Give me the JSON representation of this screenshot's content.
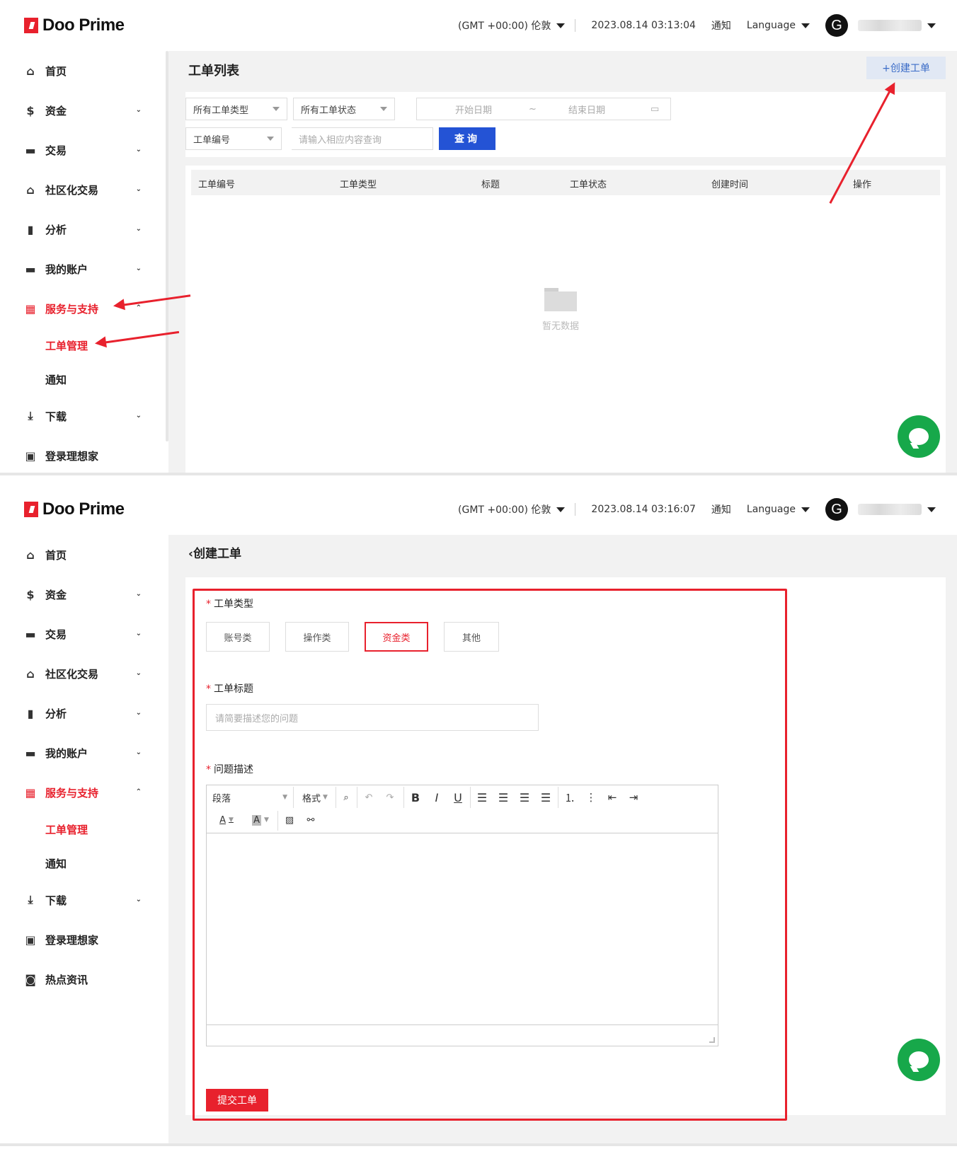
{
  "brand": {
    "name": "Doo Prime",
    "accent": "#e8212d"
  },
  "topbar_1": {
    "timezone": "(GMT +00:00) 伦敦",
    "datetime": "2023.08.14 03:13:04",
    "notify": "通知",
    "language": "Language",
    "avatar_letter": "G"
  },
  "topbar_2": {
    "timezone": "(GMT +00:00) 伦敦",
    "datetime": "2023.08.14 03:16:07",
    "notify": "通知",
    "language": "Language",
    "avatar_letter": "G"
  },
  "menu": {
    "home": "首页",
    "funds": "资金",
    "trade": "交易",
    "social": "社区化交易",
    "analysis": "分析",
    "account": "我的账户",
    "service": "服务与支持",
    "ticket": "工单管理",
    "notice": "通知",
    "download": "下载",
    "wealth": "登录理想家",
    "news": "热点资讯"
  },
  "list": {
    "title": "工单列表",
    "create_button": "+创建工单",
    "filter_type": "所有工单类型",
    "filter_status": "所有工单状态",
    "start_date": "开始日期",
    "date_sep": "~",
    "end_date": "结束日期",
    "search_field": "工单编号",
    "search_placeholder": "请输入相应内容查询",
    "query_button": "查询",
    "columns": [
      "工单编号",
      "工单类型",
      "标题",
      "工单状态",
      "创建时间",
      "操作"
    ],
    "empty_text": "暂无数据"
  },
  "create": {
    "title": "创建工单",
    "type_label": "工单类型",
    "types": [
      "账号类",
      "操作类",
      "资金类",
      "其他"
    ],
    "selected_type": "资金类",
    "subject_label": "工单标题",
    "subject_placeholder": "请简要描述您的问题",
    "desc_label": "问题描述",
    "editor_paragraph": "段落",
    "editor_format": "格式",
    "submit_button": "提交工单",
    "required_mark": "*"
  }
}
